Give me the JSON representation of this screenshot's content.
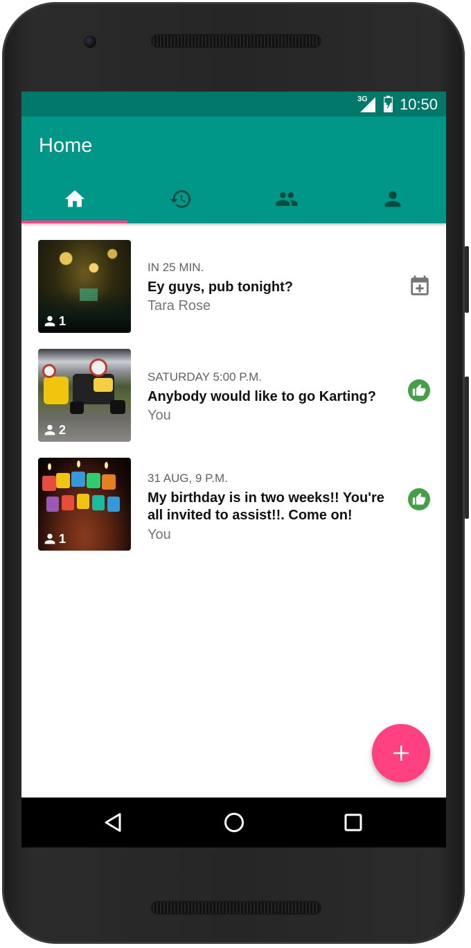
{
  "status": {
    "network": "3G",
    "time": "10:50"
  },
  "appbar": {
    "title": "Home"
  },
  "tabs": [
    {
      "name": "home",
      "icon": "home-icon",
      "selected": true
    },
    {
      "name": "history",
      "icon": "history-icon",
      "selected": false
    },
    {
      "name": "groups",
      "icon": "group-icon",
      "selected": false
    },
    {
      "name": "profile",
      "icon": "person-icon",
      "selected": false
    }
  ],
  "events": [
    {
      "when": "IN 25 MIN.",
      "title": "Ey guys, pub tonight?",
      "author": "Tara Rose",
      "attendees": "1",
      "action_icon": "calendar-add-icon",
      "image": "pub-interior"
    },
    {
      "when": "SATURDAY 5:00 P.M.",
      "title": "Anybody would like to go Karting?",
      "author": "You",
      "attendees": "2",
      "action_icon": "thumb-up-icon",
      "image": "go-kart-racing"
    },
    {
      "when": "31 AUG, 9 P.M.",
      "title": "My birthday is in two weeks!! You're all invited to assist!!. Come on!",
      "author": "You",
      "attendees": "1",
      "action_icon": "thumb-up-icon",
      "image": "birthday-candles"
    }
  ],
  "fab": {
    "icon": "plus-icon"
  },
  "navbar": {
    "buttons": [
      "back-icon",
      "home-circle-icon",
      "recents-icon"
    ]
  },
  "colors": {
    "primary": "#009688",
    "primary_dark": "#00796b",
    "accent": "#ff4081",
    "liked": "#43a047"
  }
}
